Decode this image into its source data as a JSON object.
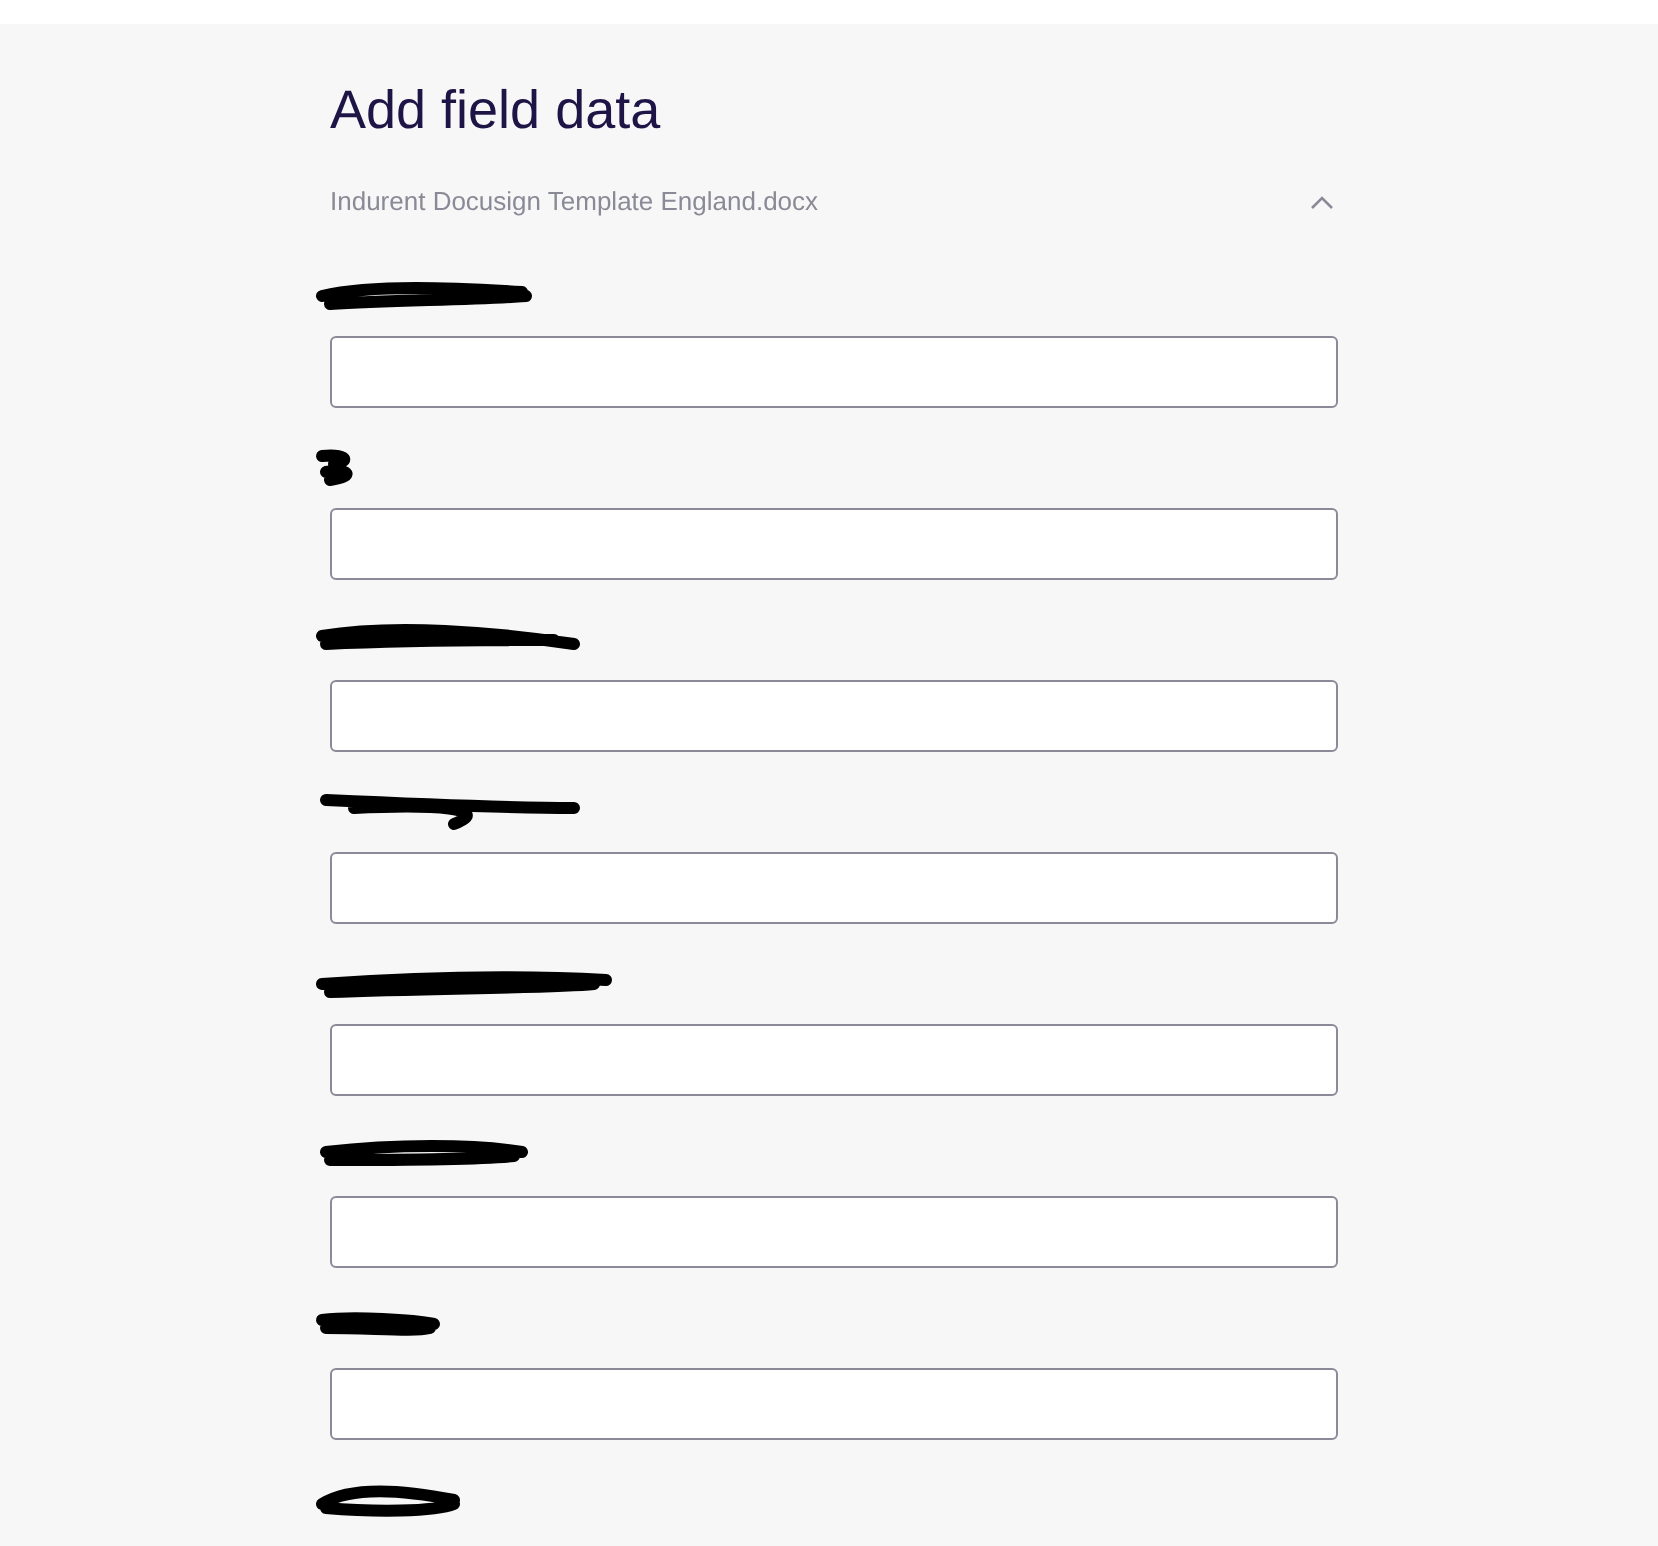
{
  "title": "Add field data",
  "document": {
    "name": "Indurent Docusign Template England.docx",
    "expanded": true
  },
  "fields": [
    {
      "kind": "input"
    },
    {
      "kind": "input"
    },
    {
      "kind": "input"
    },
    {
      "kind": "input"
    },
    {
      "kind": "input"
    },
    {
      "kind": "input"
    },
    {
      "kind": "input"
    },
    {
      "kind": "label-only"
    }
  ]
}
